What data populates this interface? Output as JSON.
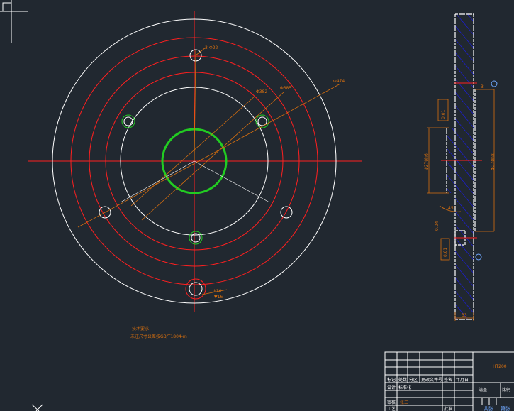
{
  "colors": {
    "background": "#212830",
    "outline": "#ffffff",
    "centerline": "#ff0000",
    "dimension": "#d9700f",
    "hatch": "#1a1aff",
    "bore": "#22cc22",
    "note": "#6fa8ff"
  },
  "front_view": {
    "labels": {
      "holes": "3-Φ22",
      "d1": "Φ382",
      "d2": "Φ385",
      "d3": "Φ474",
      "bottom_hole": "Φ16",
      "bottom_hole_depth": "▼16"
    }
  },
  "section_view": {
    "labels": {
      "left_dia": "Φ270h6",
      "right_dia": "Φ270h8",
      "width": "33",
      "step": "3",
      "angle": "45°",
      "tol1": "0.01",
      "tol2": "0.04",
      "tol3": "0.01"
    }
  },
  "notes": {
    "title": "技术要求",
    "line1": "未注尺寸公差按GB/T1804-m"
  },
  "title_block": {
    "material": "HT200",
    "part_name": "端盖",
    "scale": "比例",
    "header": [
      "标记",
      "处数",
      "分区",
      "更改文件号",
      "签名",
      "年月日"
    ],
    "row_design": "设计",
    "row_standard": "标准化",
    "row_review": "审核",
    "row_craft": "工艺",
    "row_approve": "批准",
    "drawer": "张三",
    "sheet": "共张",
    "page": "第张"
  }
}
